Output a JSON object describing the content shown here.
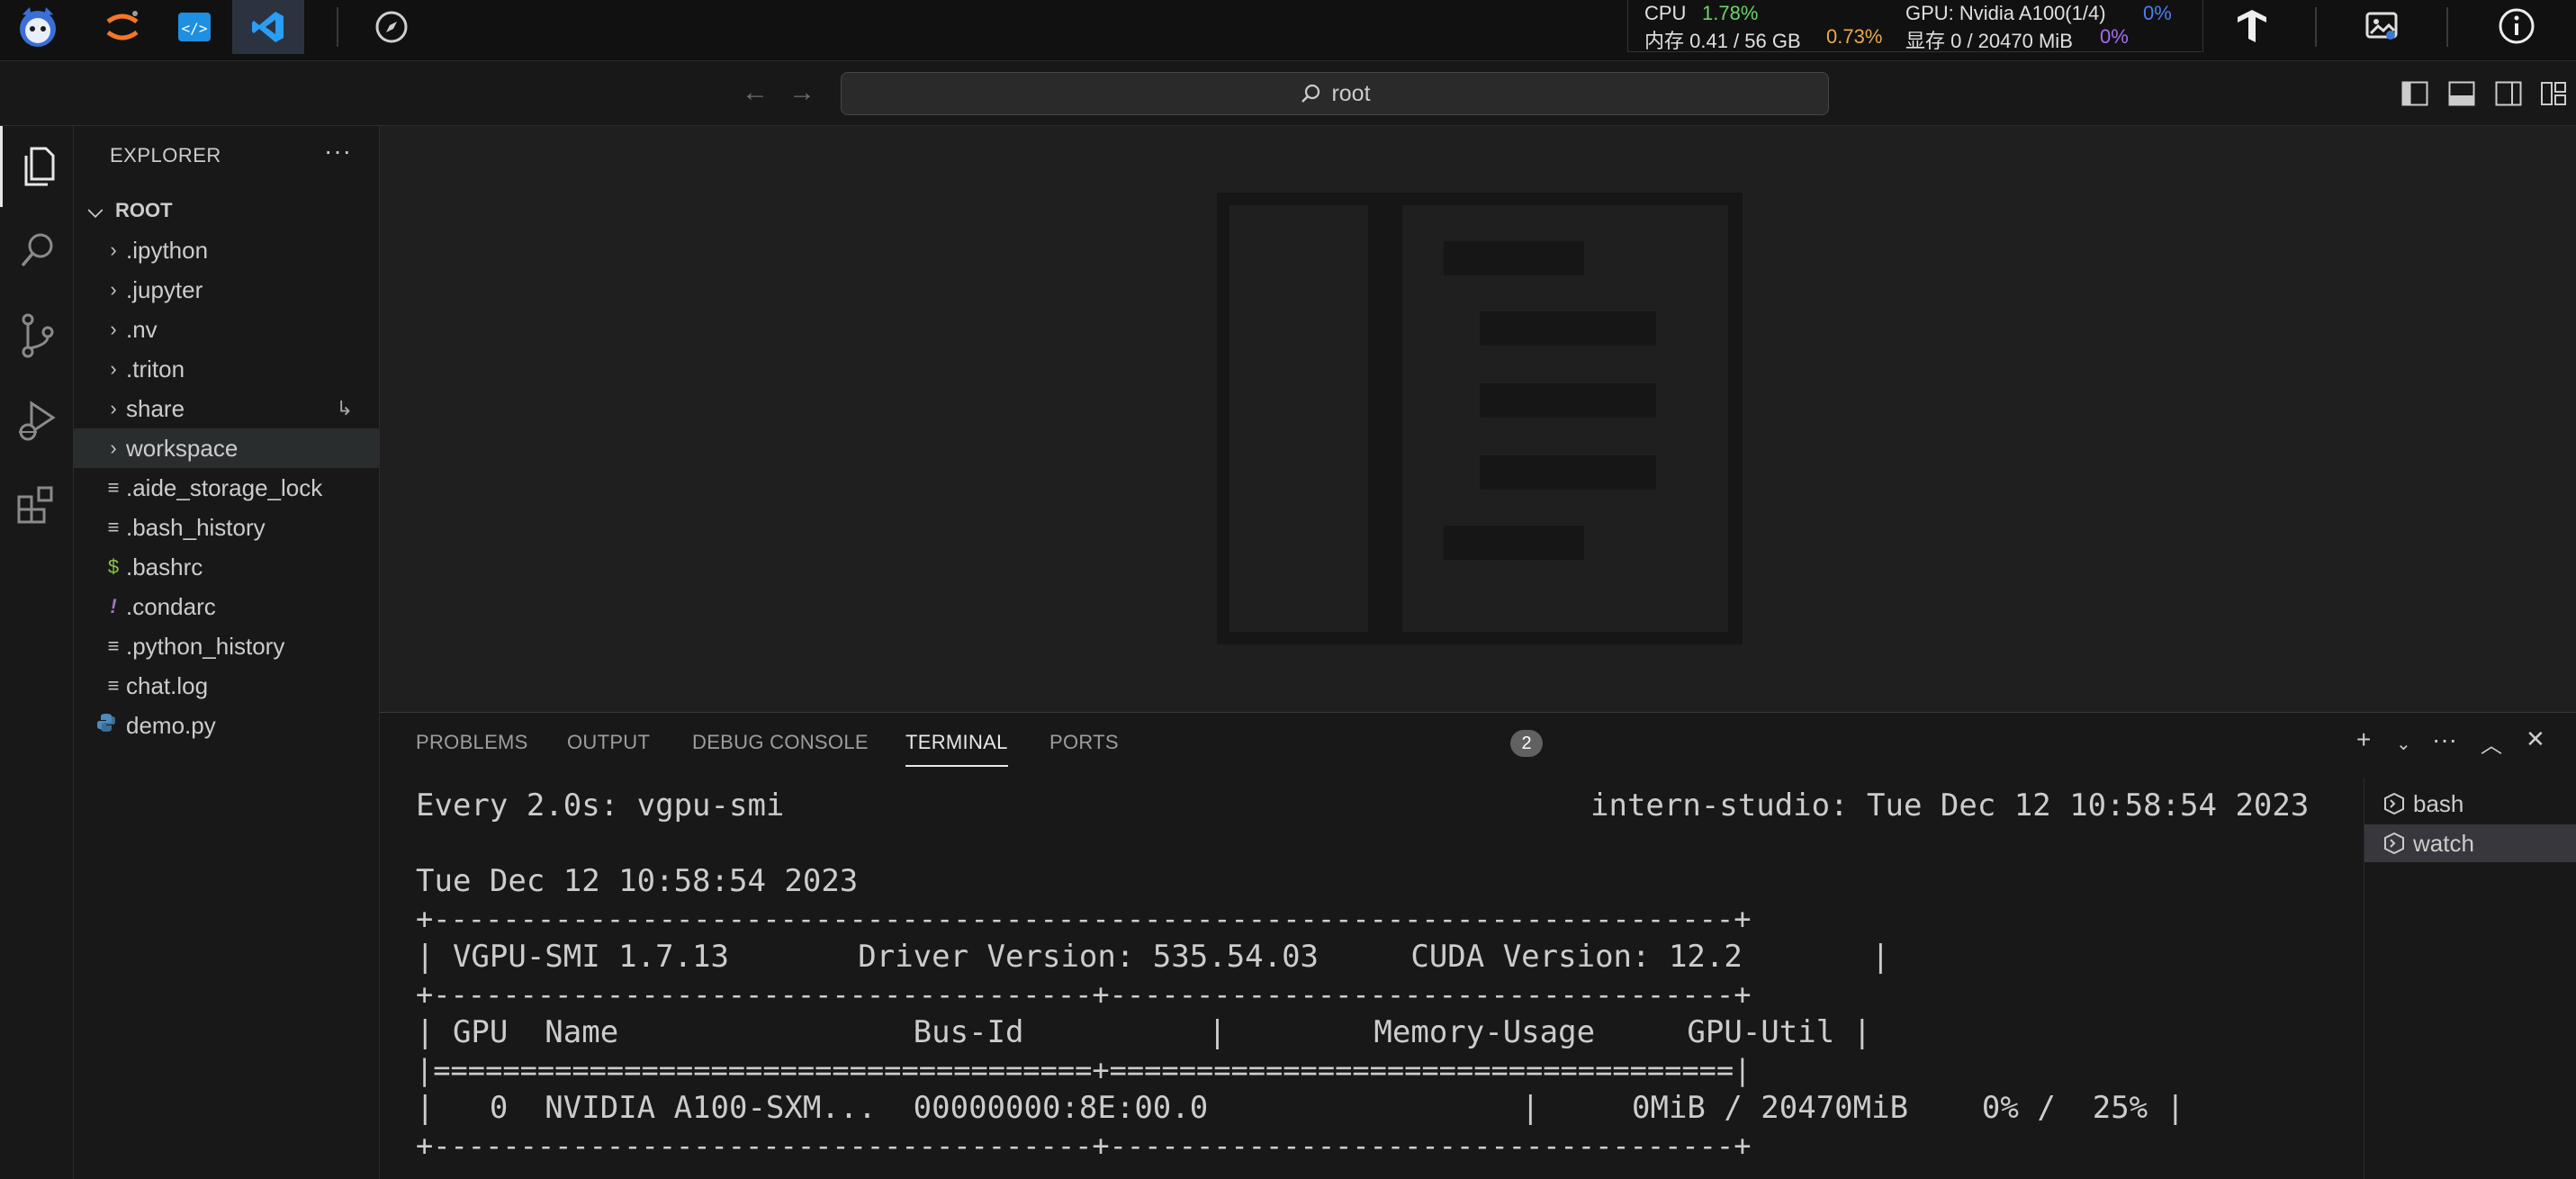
{
  "stats": {
    "cpu_label": "CPU",
    "cpu_value": "1.78%",
    "mem_label": "内存 0.41 / 56 GB",
    "mem_value": "0.73%",
    "gpu_label": "GPU: Nvidia A100(1/4)",
    "gpu_value": "0%",
    "vram_label": "显存 0 / 20470 MiB",
    "vram_value": "0%"
  },
  "command_center": {
    "text": "root"
  },
  "sidebar": {
    "title": "EXPLORER",
    "more": "···",
    "root_label": "ROOT",
    "folders": [
      ".ipython",
      ".jupyter",
      ".nv",
      ".triton",
      "share",
      "workspace"
    ],
    "files": [
      {
        "name": ".aide_storage_lock",
        "icon": "lines-file-icon"
      },
      {
        "name": ".bash_history",
        "icon": "lines-file-icon"
      },
      {
        "name": ".bashrc",
        "icon": "dollar-file-icon"
      },
      {
        "name": ".condarc",
        "icon": "exclamation-file-icon"
      },
      {
        "name": ".python_history",
        "icon": "lines-file-icon"
      },
      {
        "name": "chat.log",
        "icon": "lines-file-icon"
      },
      {
        "name": "demo.py",
        "icon": "python-icon"
      }
    ]
  },
  "panel": {
    "tabs": [
      "PROBLEMS",
      "OUTPUT",
      "DEBUG CONSOLE",
      "TERMINAL",
      "PORTS"
    ],
    "ports_count": "2",
    "terminals": [
      "bash",
      "watch"
    ]
  },
  "terminal": {
    "header_left": "Every 2.0s: vgpu-smi",
    "header_right": "intern-studio: Tue Dec 12 10:58:54 2023",
    "lines": [
      "Tue Dec 12 10:58:54 2023",
      "+---------------------------------------------------------------------------+",
      "| VGPU-SMI 1.7.13       Driver Version: 535.54.03     CUDA Version: 12.2       |",
      "+--------------------------------------+------------------------------------+",
      "| GPU  Name                Bus-Id          |        Memory-Usage     GPU-Util |",
      "|======================================+====================================|",
      "|   0  NVIDIA A100-SXM...  00000000:8E:00.0                 |     0MiB / 20470MiB    0% /  25% |",
      "+--------------------------------------+------------------------------------+"
    ]
  }
}
